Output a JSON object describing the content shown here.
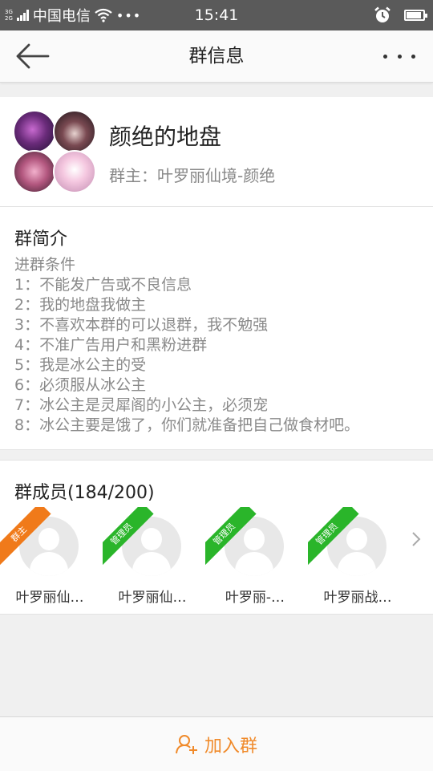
{
  "status_bar": {
    "network_top": "3G",
    "network_bottom": "2G",
    "carrier": "中国电信",
    "time": "15:41",
    "battery_level": 0.9
  },
  "nav": {
    "title": "群信息",
    "back_icon": "arrow-left-icon",
    "more_icon": "more-dots-icon"
  },
  "group": {
    "name": "颜绝的地盘",
    "owner": "群主：叶罗丽仙境-颜绝"
  },
  "intro": {
    "title": "群简介",
    "lines": [
      "进群条件",
      "1：不能发广告或不良信息",
      "2：我的地盘我做主",
      "3：不喜欢本群的可以退群，我不勉强",
      "4：不准广告用户和黑粉进群",
      "5：我是冰公主的受",
      "6：必须服从冰公主",
      "7：冰公主是灵犀阁的小公主，必须宠",
      "8：冰公主要是饿了，你们就准备把自己做食材吧。"
    ]
  },
  "members": {
    "title": "群成员(184/200)",
    "list": [
      {
        "badge": "群主",
        "badge_color": "#f07a1a",
        "name": "叶罗丽仙…"
      },
      {
        "badge": "管理员",
        "badge_color": "#2ab52a",
        "name": "叶罗丽仙…"
      },
      {
        "badge": "管理员",
        "badge_color": "#2ab52a",
        "name": "叶罗丽-…"
      },
      {
        "badge": "管理员",
        "badge_color": "#2ab52a",
        "name": "叶罗丽战…"
      }
    ]
  },
  "bottom": {
    "join_label": "加入群",
    "accent": "#f08a2a"
  }
}
